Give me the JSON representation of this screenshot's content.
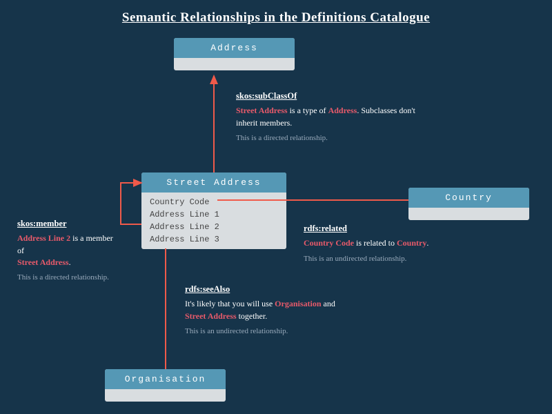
{
  "title": "Semantic Relationships in the Definitions Catalogue",
  "nodes": {
    "address": {
      "header": "Address"
    },
    "street": {
      "header": "Street Address",
      "items": [
        "Country Code",
        "Address Line 1",
        "Address Line 2",
        "Address Line 3"
      ]
    },
    "country": {
      "header": "Country"
    },
    "organisation": {
      "header": "Organisation"
    }
  },
  "labels": {
    "subClassOf": {
      "title": "skos:subClassOf",
      "text_pre": "",
      "hl1": "Street Address",
      "text_mid": " is a type of ",
      "hl2": "Address",
      "text_post": ". Subclasses don't inherit members.",
      "note": "This is a directed relationship."
    },
    "member": {
      "title": "skos:member",
      "hl1": "Address Line 2",
      "text_mid": " is a member of ",
      "hl2": "Street Address",
      "text_post": ".",
      "note": "This is a directed relationship."
    },
    "related": {
      "title": "rdfs:related",
      "hl1": "Country Code",
      "text_mid": " is related to ",
      "hl2": "Country",
      "text_post": ".",
      "note": "This is an undirected relationship."
    },
    "seeAlso": {
      "title": "rdfs:seeAlso",
      "text_pre": "It's likely that you will use ",
      "hl1": "Organisation",
      "text_mid": " and ",
      "hl2": "Street Address",
      "text_post": " together.",
      "note": "This is an undirected relationship."
    }
  }
}
